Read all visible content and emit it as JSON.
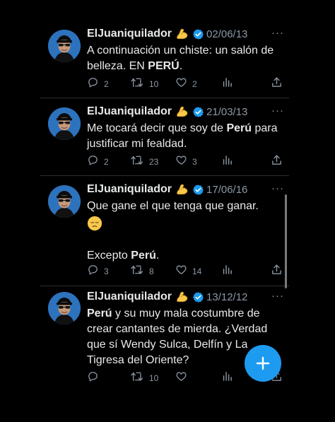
{
  "colors": {
    "accent": "#1d9bf0",
    "background": "#000000",
    "text": "#e7e9ea",
    "muted": "#8b98a5"
  },
  "tweets": [
    {
      "username": "ElJuaniquilador",
      "date": "02/06/13",
      "more": "···",
      "text_parts": [
        "A continuación un chiste: un salón de belleza. EN ",
        "PERÚ",
        "."
      ],
      "replies": "2",
      "retweets": "10",
      "likes": "2"
    },
    {
      "username": "ElJuaniquilador",
      "date": "21/03/13",
      "more": "···",
      "text_parts": [
        "Me tocará decir que soy de ",
        "Perú",
        " para justificar mi fealdad."
      ],
      "replies": "2",
      "retweets": "23",
      "likes": "3"
    },
    {
      "username": "ElJuaniquilador",
      "date": "17/06/16",
      "more": "···",
      "text_line1": "Que gane el que tenga que ganar.",
      "text_line2_parts": [
        "Excepto ",
        "Perú",
        "."
      ],
      "replies": "3",
      "retweets": "8",
      "likes": "14"
    },
    {
      "username": "ElJuaniquilador",
      "date": "13/12/12",
      "more": "···",
      "text_parts": [
        "Perú",
        " y su muy mala costumbre de crear cantantes de mierda. ¿Verdad que sí Wendy Sulca, Delfín y La Tigresa del Oriente?"
      ],
      "replies": "",
      "retweets": "10",
      "likes": ""
    }
  ],
  "fab": {
    "label": "+"
  },
  "icons": {
    "verified": "verified-badge-icon",
    "emoji_name": "flexed-biceps-emoji-icon",
    "reply": "reply-icon",
    "retweet": "retweet-icon",
    "like": "heart-icon",
    "views": "analytics-icon",
    "share": "share-icon",
    "sad_emoji": "pensive-face-emoji-icon"
  }
}
